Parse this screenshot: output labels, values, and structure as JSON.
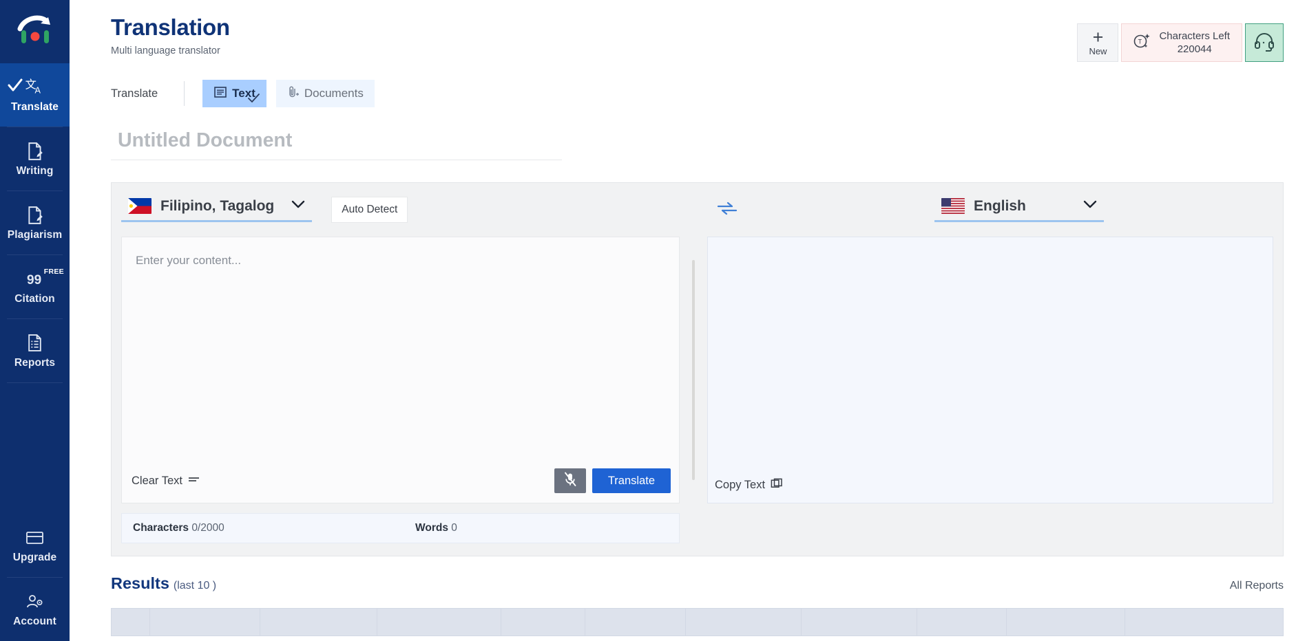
{
  "sidebar": {
    "logo_name": "trinka-logo",
    "items": [
      {
        "label": "Translate",
        "icon": "translate-icon",
        "active": true,
        "badge": ""
      },
      {
        "label": "Writing",
        "icon": "document-edit-icon",
        "active": false,
        "badge": ""
      },
      {
        "label": "Plagiarism",
        "icon": "document-edit-icon",
        "active": false,
        "badge": ""
      },
      {
        "label": "Citation",
        "icon": "quote-icon",
        "active": false,
        "badge": "FREE"
      },
      {
        "label": "Reports",
        "icon": "report-icon",
        "active": false,
        "badge": ""
      }
    ],
    "bottom_items": [
      {
        "label": "Upgrade",
        "icon": "credit-card-icon"
      },
      {
        "label": "Account",
        "icon": "account-settings-icon"
      }
    ]
  },
  "header": {
    "title": "Translation",
    "subtitle": "Multi language translator",
    "new_button": {
      "label": "New",
      "icon": "plus-icon"
    },
    "characters": {
      "line1": "Characters Left",
      "line2": "220044",
      "icon": "text-credits-icon"
    },
    "support": {
      "icon": "headset-icon"
    }
  },
  "tabs": {
    "label": "Translate",
    "items": [
      {
        "label": "Text",
        "icon": "text-lines-icon",
        "active": true
      },
      {
        "label": "Documents",
        "icon": "attachment-icon",
        "active": false
      }
    ]
  },
  "document": {
    "title_value": "",
    "title_placeholder": "Untitled Document"
  },
  "translator": {
    "source": {
      "language": "Filipino, Tagalog",
      "flag": "ph-flag",
      "auto_detect_label": "Auto Detect",
      "placeholder": "Enter your content...",
      "value": "",
      "clear_label": "Clear Text",
      "mic_icon": "mic-off-icon",
      "translate_label": "Translate",
      "characters_label": "Characters",
      "characters_value": "0/2000",
      "words_label": "Words",
      "words_value": "0"
    },
    "swap_icon": "swap-arrows-icon",
    "target": {
      "language": "English",
      "flag": "us-flag",
      "value": "",
      "copy_label": "Copy Text",
      "copy_icon": "copy-icon"
    }
  },
  "results": {
    "title": "Results",
    "subtitle": "(last 10 )",
    "all_reports_label": "All Reports",
    "columns": [
      "",
      "",
      "",
      "",
      "",
      "",
      "",
      "",
      "",
      "",
      ""
    ]
  },
  "colors": {
    "sidebar_bg": "#0e2f6e",
    "sidebar_active": "#10489b",
    "title_blue": "#0f3377",
    "primary_button": "#1f63d4",
    "tab_active": "#a9ceff",
    "chars_bg": "#fdf1f1",
    "support_bg": "#c6ead8",
    "output_bg": "#f4f7fd"
  }
}
